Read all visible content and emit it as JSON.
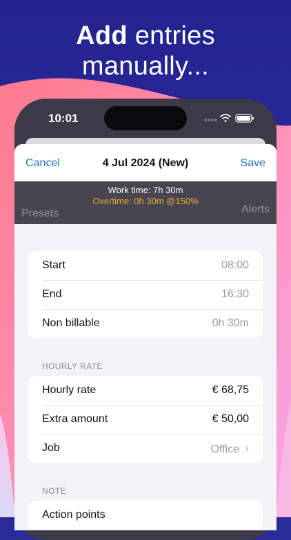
{
  "headline": {
    "bold": "Add",
    "rest1": " entries",
    "line2": "manually..."
  },
  "status": {
    "time": "10:01"
  },
  "nav": {
    "cancel": "Cancel",
    "title": "4 Jul 2024 (New)",
    "save": "Save"
  },
  "summary": {
    "work_time": "Work time: 7h 30m",
    "overtime": "Overtime: 0h 30m  @150%",
    "presets": "Presets",
    "alerts": "Alerts"
  },
  "times": [
    {
      "label": "Start",
      "value": "08:00"
    },
    {
      "label": "End",
      "value": "16:30"
    },
    {
      "label": "Non billable",
      "value": "0h 30m"
    }
  ],
  "hourly_rate": {
    "header": "HOURLY RATE",
    "rows": [
      {
        "label": "Hourly rate",
        "value": "€ 68,75"
      },
      {
        "label": "Extra amount",
        "value": "€ 50,00"
      },
      {
        "label": "Job",
        "value": "Office"
      }
    ]
  },
  "note": {
    "header": "NOTE",
    "first_row": "Action points"
  },
  "colors": {
    "accent": "#1a73c9",
    "overtime": "#f0a63a",
    "summary_bg": "#47454f"
  }
}
